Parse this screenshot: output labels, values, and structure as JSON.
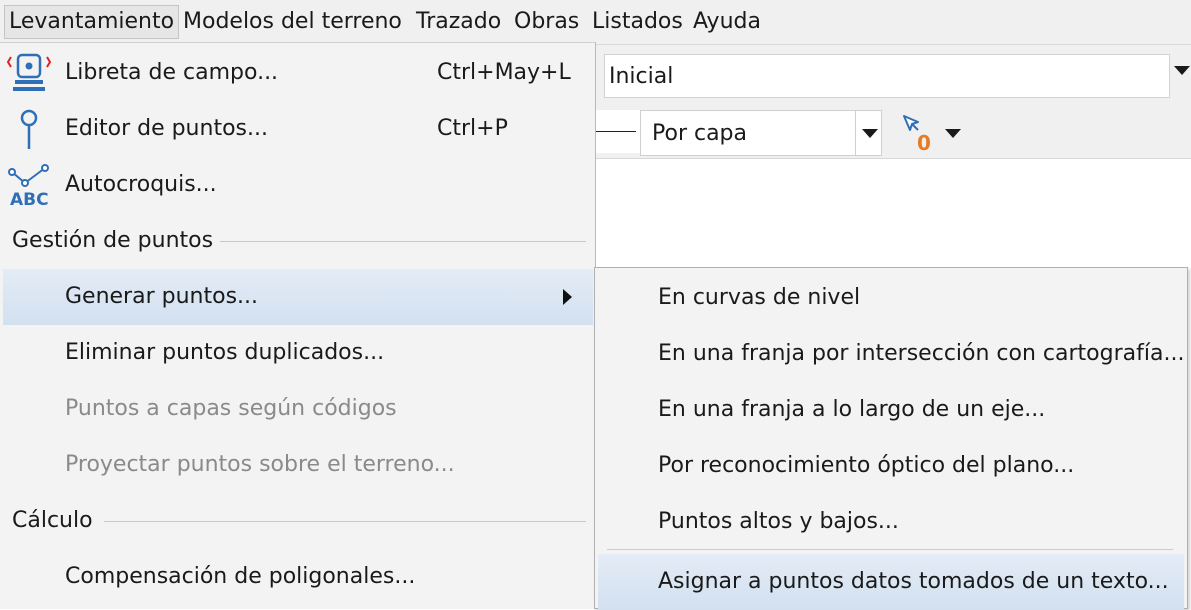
{
  "menubar": {
    "items": [
      {
        "label": "Levantamiento"
      },
      {
        "label": "Modelos del terreno"
      },
      {
        "label": "Trazado"
      },
      {
        "label": "Obras"
      },
      {
        "label": "Listados"
      },
      {
        "label": "Ayuda"
      }
    ]
  },
  "toolbar": {
    "view_combo_value": "Inicial",
    "line_combo_value": "Por capa",
    "selection_count": "0"
  },
  "menu": {
    "items": [
      {
        "label": "Libreta de campo...",
        "shortcut": "Ctrl+May+L",
        "icon": "field-book-icon"
      },
      {
        "label": "Editor de puntos...",
        "shortcut": "Ctrl+P",
        "icon": "point-pin-icon"
      },
      {
        "label": "Autocroquis...",
        "icon": "autosketch-abc-icon"
      }
    ],
    "section_points": "Gestión de puntos",
    "points_items": [
      {
        "label": "Generar puntos..."
      },
      {
        "label": "Eliminar puntos duplicados..."
      },
      {
        "label": "Puntos a capas según códigos",
        "disabled": true
      },
      {
        "label": "Proyectar puntos sobre el terreno...",
        "disabled": true
      }
    ],
    "section_calc": "Cálculo",
    "calc_items": [
      {
        "label": "Compensación de poligonales..."
      }
    ]
  },
  "submenu": {
    "items": [
      {
        "label": "En curvas de nivel"
      },
      {
        "label": "En una franja por intersección con cartografía..."
      },
      {
        "label": "En una franja a lo largo de un eje..."
      },
      {
        "label": "Por reconocimiento óptico del plano..."
      },
      {
        "label": "Puntos altos y bajos..."
      },
      {
        "label": "Asignar a puntos datos tomados de un texto..."
      }
    ]
  },
  "colors": {
    "icon_blue": "#2f6fb8",
    "icon_red": "#e02020",
    "selection_orange": "#e87a22",
    "highlight": "#d8e4f2"
  }
}
